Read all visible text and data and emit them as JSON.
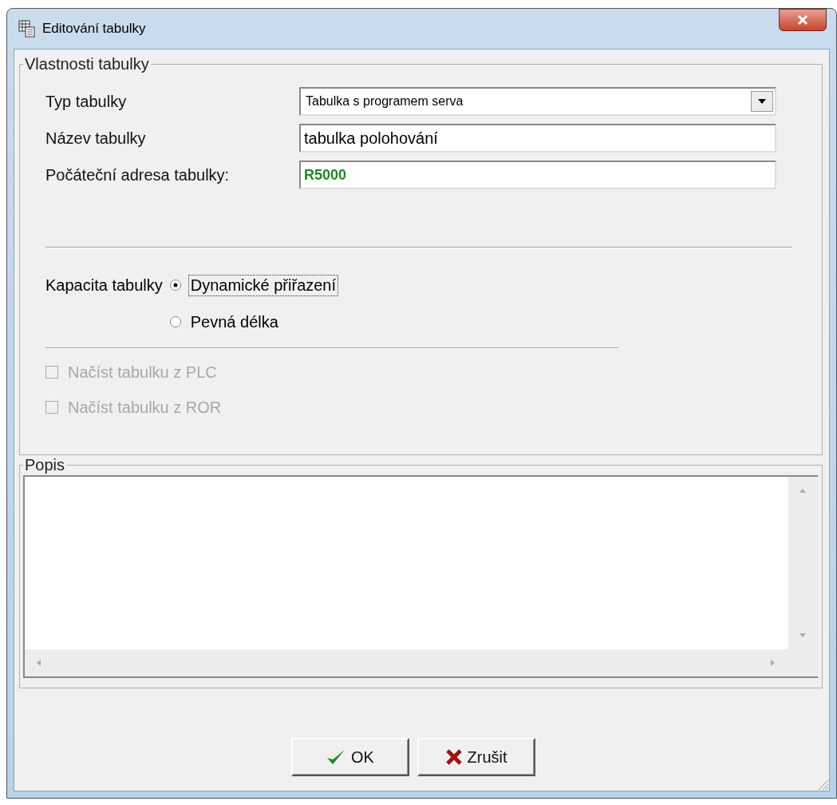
{
  "window": {
    "title": "Editování tabulky"
  },
  "properties": {
    "title": "Vlastnosti tabulky",
    "fields": [
      {
        "kind": "dropdown",
        "label": "Typ tabulky",
        "value": "Tabulka s programem serva"
      },
      {
        "kind": "text",
        "label": "Název tabulky",
        "value": "tabulka polohování"
      },
      {
        "kind": "address",
        "label": "Počáteční adresa tabulky:",
        "value": "R5000"
      }
    ],
    "capacity": {
      "label": "Kapacita tabulky",
      "options": [
        {
          "label": "Dynamické přiřazení",
          "selected": true,
          "focused": true
        },
        {
          "label": "Pevná délka",
          "selected": false,
          "focused": false
        }
      ]
    },
    "checkboxes": [
      {
        "label": "Načíst tabulku z PLC",
        "checked": false,
        "disabled": true
      },
      {
        "label": "Načíst tabulku z ROR",
        "checked": false,
        "disabled": true
      }
    ]
  },
  "description": {
    "title": "Popis"
  },
  "buttons": [
    {
      "kind": "ok",
      "label": "OK"
    },
    {
      "kind": "cancel",
      "label": "Zrušit"
    }
  ]
}
